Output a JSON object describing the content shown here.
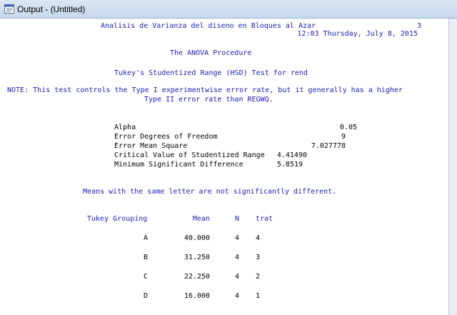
{
  "window": {
    "title": "Output - (Untitled)",
    "icon": "sas-output-icon"
  },
  "header": {
    "title": "Analisis de Varianza del diseno en Bloques al Azar",
    "page_number": "3",
    "timestamp": "12:03 Thursday, July 8, 2015",
    "procedure": "The ANOVA Procedure",
    "test_title": "Tukey's Studentized Range (HSD) Test for rend"
  },
  "note": {
    "line1": "NOTE: This test controls the Type I experimentwise error rate, but it generally has a higher",
    "line2": "Type II error rate than REGWQ."
  },
  "stats": [
    {
      "label": "Alpha",
      "value": "0.05"
    },
    {
      "label": "Error Degrees of Freedom",
      "value": "9"
    },
    {
      "label": "Error Mean Square",
      "value": "7.027778"
    },
    {
      "label": "Critical Value of Studentized Range",
      "value": "4.41490"
    },
    {
      "label": "Minimum Significant Difference",
      "value": "5.8519"
    }
  ],
  "means_note": "Means with the same letter are not significantly different.",
  "table": {
    "headers": {
      "grouping": "Tukey Grouping",
      "mean": "Mean",
      "n": "N",
      "trat": "trat"
    },
    "rows": [
      {
        "grouping": "A",
        "mean": "40.000",
        "n": "4",
        "trat": "4"
      },
      {
        "grouping": "B",
        "mean": "31.250",
        "n": "4",
        "trat": "3"
      },
      {
        "grouping": "C",
        "mean": "22.250",
        "n": "4",
        "trat": "2"
      },
      {
        "grouping": "D",
        "mean": "16.000",
        "n": "4",
        "trat": "1"
      }
    ]
  },
  "colors": {
    "text_blue": "#1c1cb4",
    "text_black": "#000000",
    "titlebar": "#c7d8ee"
  }
}
